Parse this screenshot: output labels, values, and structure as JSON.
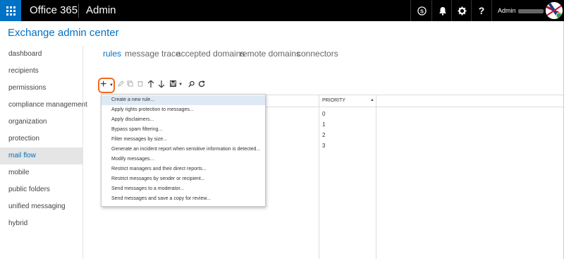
{
  "topbar": {
    "brand": "Office 365",
    "app_title": "Admin",
    "user_name": "Admin",
    "icons": [
      "app-launcher-icon",
      "skype-icon",
      "bell-icon",
      "gear-icon",
      "help-icon"
    ],
    "accent": "#0072c6"
  },
  "header": {
    "title": "Exchange admin center"
  },
  "nav": {
    "items": [
      {
        "label": "dashboard"
      },
      {
        "label": "recipients"
      },
      {
        "label": "permissions"
      },
      {
        "label": "compliance management"
      },
      {
        "label": "organization"
      },
      {
        "label": "protection"
      },
      {
        "label": "mail flow"
      },
      {
        "label": "mobile"
      },
      {
        "label": "public folders"
      },
      {
        "label": "unified messaging"
      },
      {
        "label": "hybrid"
      }
    ],
    "active": "mail flow"
  },
  "tabs": [
    {
      "label": "rules"
    },
    {
      "label": "message trace"
    },
    {
      "label": "accepted domains"
    },
    {
      "label": "remote domains"
    },
    {
      "label": "connectors"
    }
  ],
  "toolbar": {
    "icons": [
      "plus-icon",
      "pencil-icon",
      "copy-icon",
      "delete-icon",
      "arrow-up-icon",
      "arrow-down-icon",
      "save-icon",
      "search-icon",
      "refresh-icon"
    ],
    "plus_glyph": "+",
    "highlight_color": "#f26b21"
  },
  "table": {
    "priority_header": "PRIORITY",
    "priorities": [
      "0",
      "1",
      "2",
      "3"
    ]
  },
  "menu": {
    "items": [
      {
        "label": "Create a new rule..."
      },
      {
        "label": "Apply rights protection to messages..."
      },
      {
        "label": "Apply disclaimers..."
      },
      {
        "label": "Bypass spam filtering..."
      },
      {
        "label": "Filter messages by size..."
      },
      {
        "label": "Generate an incident report when sensitive information is detected..."
      },
      {
        "label": "Modify messages..."
      },
      {
        "label": "Restrict managers and their direct reports..."
      },
      {
        "label": "Restrict messages by sender or recipient..."
      },
      {
        "label": "Send messages to a moderator..."
      },
      {
        "label": "Send messages and save a copy for review..."
      }
    ],
    "hovered_index": 0
  }
}
